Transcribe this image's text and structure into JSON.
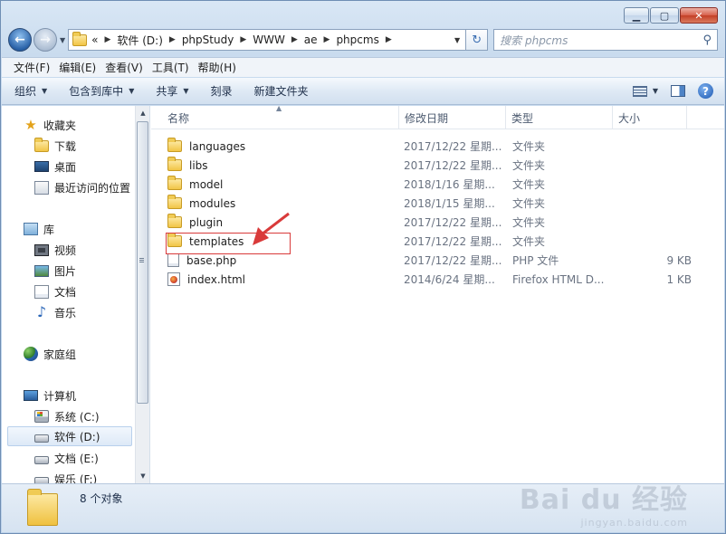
{
  "window": {
    "buttons": {
      "minimize": "▁",
      "maximize": "▢",
      "close": "✕"
    }
  },
  "address": {
    "prefix": "«",
    "crumbs": [
      "软件 (D:)",
      "phpStudy",
      "WWW",
      "ae",
      "phpcms"
    ],
    "refresh_icon": "↻"
  },
  "search": {
    "placeholder": "搜索 phpcms",
    "icon": "magnifier-icon"
  },
  "menu": [
    "文件(F)",
    "编辑(E)",
    "查看(V)",
    "工具(T)",
    "帮助(H)"
  ],
  "commands": [
    "组织",
    "包含到库中",
    "共享",
    "刻录",
    "新建文件夹"
  ],
  "nav": {
    "favorites": {
      "header": "收藏夹",
      "items": [
        "下载",
        "桌面",
        "最近访问的位置"
      ]
    },
    "libraries": {
      "header": "库",
      "items": [
        "视频",
        "图片",
        "文档",
        "音乐"
      ]
    },
    "homegroup": "家庭组",
    "computer": {
      "header": "计算机",
      "items": [
        "系统 (C:)",
        "软件 (D:)",
        "文档 (E:)",
        "娱乐 (F:)"
      ]
    }
  },
  "columns": [
    "名称",
    "修改日期",
    "类型",
    "大小"
  ],
  "files": [
    {
      "name": "languages",
      "date": "2017/12/22 星期...",
      "type": "文件夹",
      "size": "",
      "kind": "folder"
    },
    {
      "name": "libs",
      "date": "2017/12/22 星期...",
      "type": "文件夹",
      "size": "",
      "kind": "folder"
    },
    {
      "name": "model",
      "date": "2018/1/16 星期...",
      "type": "文件夹",
      "size": "",
      "kind": "folder"
    },
    {
      "name": "modules",
      "date": "2018/1/15 星期...",
      "type": "文件夹",
      "size": "",
      "kind": "folder"
    },
    {
      "name": "plugin",
      "date": "2017/12/22 星期...",
      "type": "文件夹",
      "size": "",
      "kind": "folder"
    },
    {
      "name": "templates",
      "date": "2017/12/22 星期...",
      "type": "文件夹",
      "size": "",
      "kind": "folder"
    },
    {
      "name": "base.php",
      "date": "2017/12/22 星期...",
      "type": "PHP 文件",
      "size": "9 KB",
      "kind": "php"
    },
    {
      "name": "index.html",
      "date": "2014/6/24 星期...",
      "type": "Firefox HTML D...",
      "size": "1 KB",
      "kind": "html"
    }
  ],
  "status": {
    "count": "8 个对象"
  },
  "watermark": {
    "main": "Bai du 经验",
    "sub": "jingyan.baidu.com"
  },
  "colors": {
    "annotation_red": "#d93a3a",
    "accent": "#2a62a8"
  }
}
